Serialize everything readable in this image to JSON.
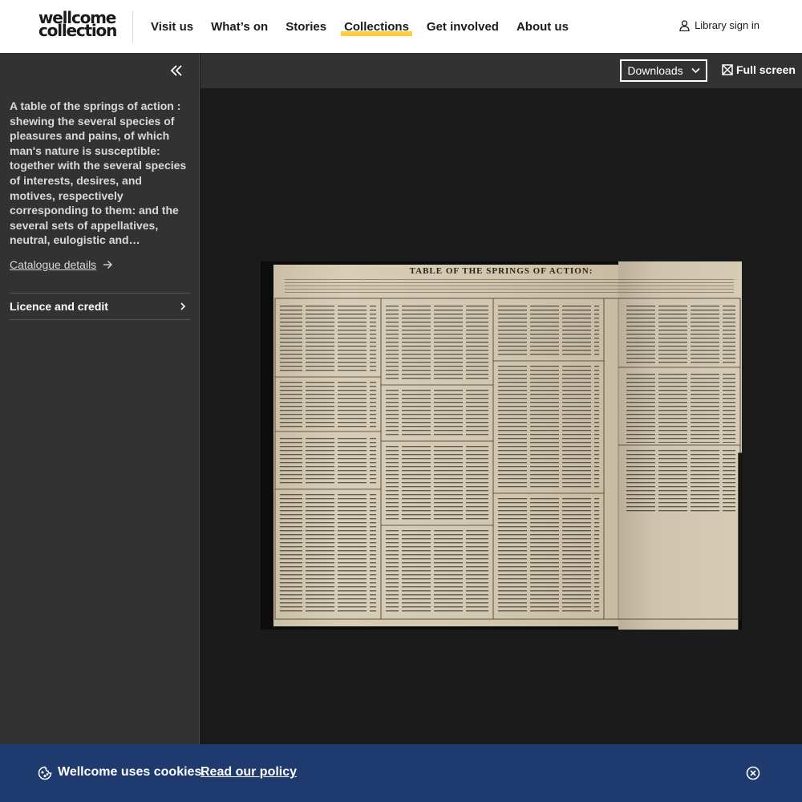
{
  "header": {
    "logo_line1": "wellcome",
    "logo_line2": "collection",
    "nav": [
      {
        "label": "Visit us"
      },
      {
        "label": "What’s on"
      },
      {
        "label": "Stories"
      },
      {
        "label": "Collections",
        "active": true
      },
      {
        "label": "Get involved"
      },
      {
        "label": "About us"
      }
    ],
    "signin_label": "Library sign in",
    "signin_icon": "user-icon"
  },
  "sidebar": {
    "collapse_icon": "double-chevron-left-icon",
    "title": "A table of the springs of action : shewing the several species of pleasures and pains, of which man's nature is susceptible: together with the several species of interests, desires, and motives, respectively corresponding to them: and the several sets of appellatives, neutral, eulogistic and dyslogistic, by which each species of motive is wont to be designated",
    "catalogue_link": "Catalogue details",
    "licence_label": "Licence and credit"
  },
  "toolbar": {
    "downloads_label": "Downloads",
    "fullscreen_label": "Full screen"
  },
  "viewer": {
    "document_heading": "TABLE OF THE SPRINGS OF ACTION:"
  },
  "cookie": {
    "message": "Wellcome uses cookies.",
    "link": "Read our policy",
    "icon": "cookie-icon",
    "close_icon": "close-circle-icon"
  },
  "colors": {
    "accent": "#ffce3c",
    "cookie_bg": "#1e3a6e",
    "sidebar_bg": "#323232"
  }
}
